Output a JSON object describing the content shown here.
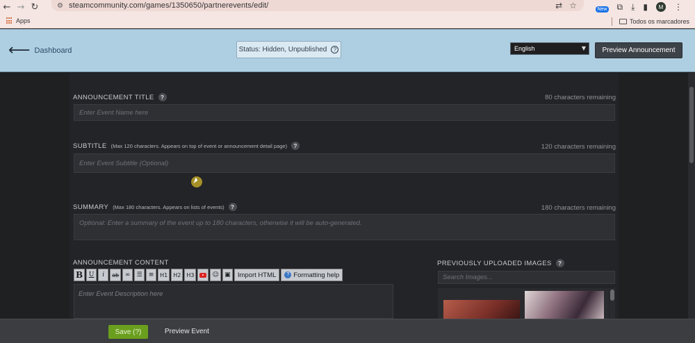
{
  "browser": {
    "url": "steamcommunity.com/games/1350650/partnerevents/edit/",
    "extension_badge": "New",
    "profile_initial": "M",
    "bookmarks": {
      "apps_label": "Apps",
      "folder_label": "Todos os marcadores"
    }
  },
  "header": {
    "back_label": "Dashboard",
    "status_text": "Status: Hidden, Unpublished",
    "language_selected": "English",
    "preview_announcement_label": "Preview Announcement"
  },
  "form": {
    "title": {
      "label": "ANNOUNCEMENT TITLE",
      "remaining": "80 characters remaining",
      "placeholder": "Enter Event Name here"
    },
    "subtitle": {
      "label": "SUBTITLE",
      "note": "(Max 120 characters. Appears on top of event or announcement detail page)",
      "remaining": "120 characters remaining",
      "placeholder": "Enter Event Subtitle (Optional)"
    },
    "summary": {
      "label": "SUMMARY",
      "note": "(Max 180 characters. Appears on lists of events)",
      "remaining": "180 characters remaining",
      "placeholder": "Optional: Enter a summary of the event up to 180 characters, otherwise it will be auto-generated."
    },
    "content": {
      "label": "ANNOUNCEMENT CONTENT",
      "placeholder": "Enter Event Description here",
      "toolbar": {
        "bold": "B",
        "underline": "U",
        "italic": "i",
        "strike": "ab",
        "link": "∞",
        "h1": "H1",
        "h2": "H2",
        "h3": "H3",
        "import_html": "Import HTML",
        "formatting_help": "Formatting help"
      }
    },
    "images": {
      "label": "PREVIOUSLY UPLOADED IMAGES",
      "search_placeholder": "Search Images..."
    }
  },
  "footer": {
    "save_label": "Save (?)",
    "preview_event_label": "Preview Event"
  },
  "colors": {
    "header_bg": "#aecfe2",
    "save_green": "#6a9f1e",
    "editor_bg": "#232427"
  }
}
